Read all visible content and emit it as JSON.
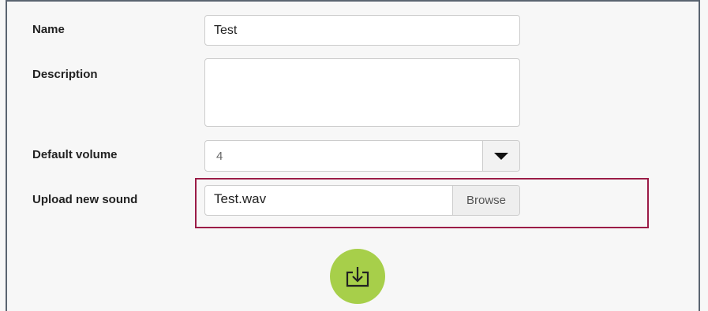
{
  "form": {
    "name": {
      "label": "Name",
      "value": "Test"
    },
    "description": {
      "label": "Description",
      "value": ""
    },
    "default_volume": {
      "label": "Default volume",
      "selected": "4"
    },
    "upload": {
      "label": "Upload new sound",
      "file_name": "Test.wav",
      "browse_label": "Browse"
    }
  },
  "save_button": {
    "icon": "download-tray-icon"
  },
  "colors": {
    "highlight_border": "#9b1c47",
    "save_button_bg": "#a7cf4a",
    "icon_stroke": "#222222"
  }
}
